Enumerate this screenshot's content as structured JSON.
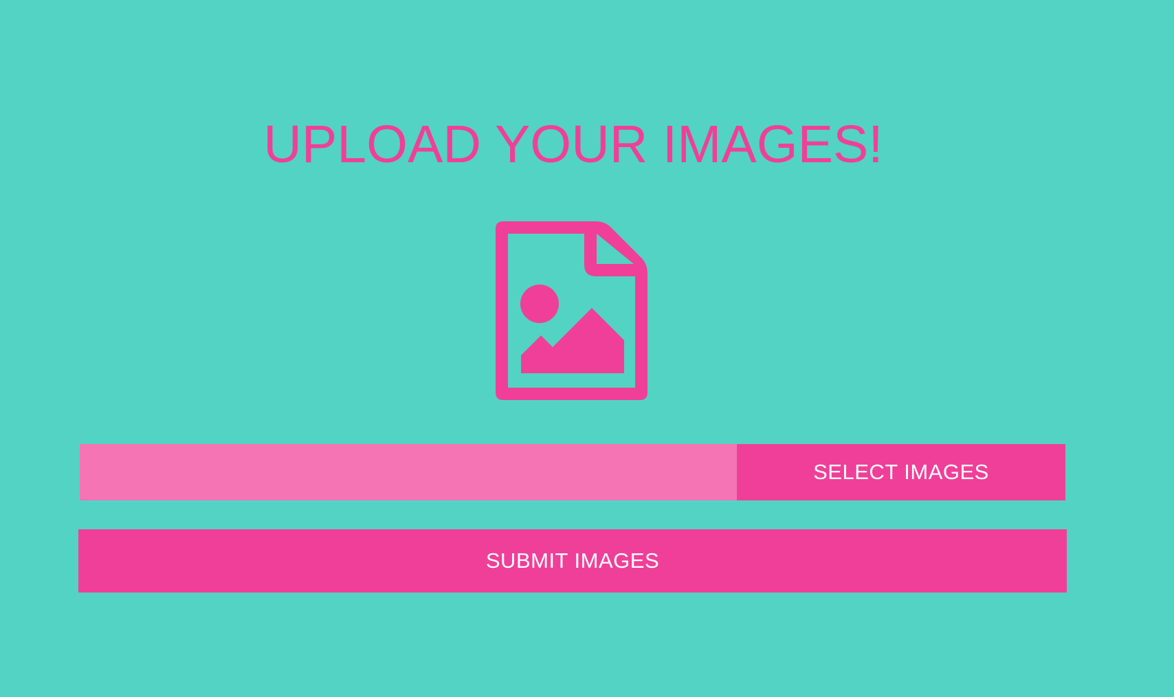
{
  "header": {
    "title": "UPLOAD YOUR IMAGES!"
  },
  "icon": {
    "name": "file-image-icon"
  },
  "upload": {
    "file_input_value": "",
    "select_label": "SELECT IMAGES",
    "submit_label": "SUBMIT IMAGES"
  },
  "colors": {
    "background": "#53d3c3",
    "accent": "#f03f98",
    "input_background": "#f574b3",
    "button_text": "#ffffff"
  }
}
